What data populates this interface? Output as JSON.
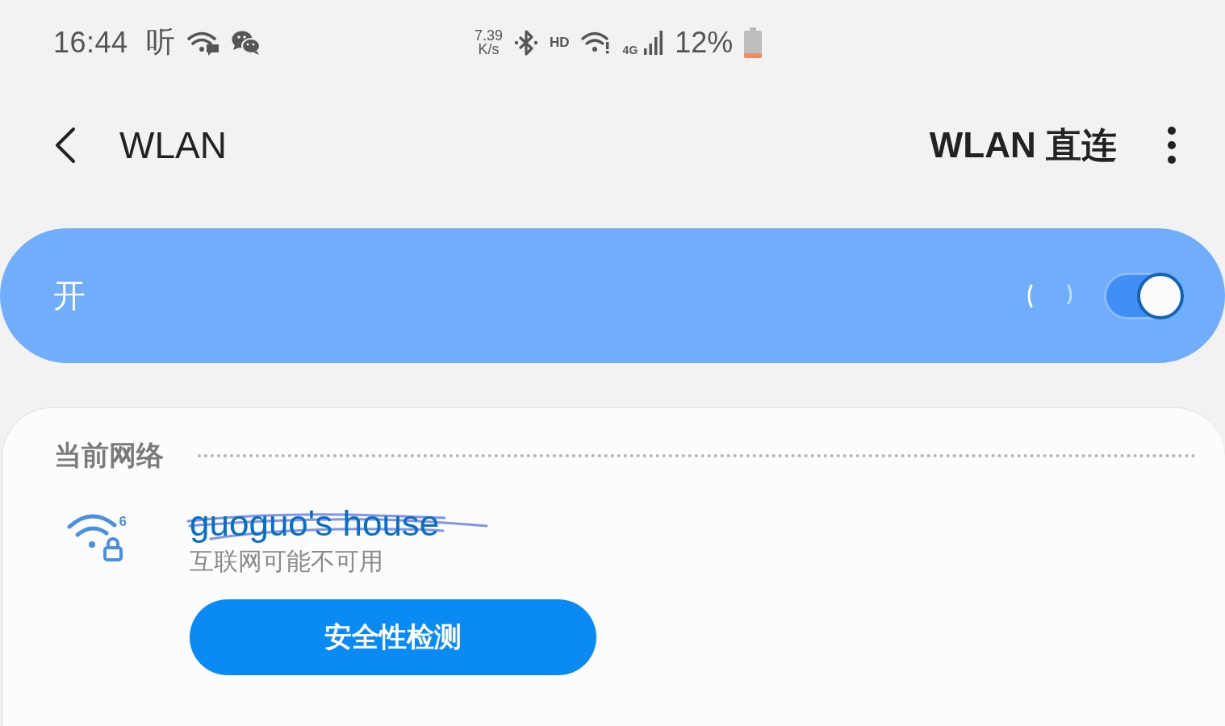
{
  "status_bar": {
    "time": "16:44",
    "notification_glyph": "听",
    "net_speed_value": "7.39",
    "net_speed_unit": "K/s",
    "hd_label": "HD",
    "network_type": "4G",
    "battery_percent": "12%"
  },
  "header": {
    "title": "WLAN",
    "action": "WLAN 直连"
  },
  "master_switch": {
    "label": "开",
    "on": true,
    "busy": true
  },
  "current_network": {
    "section_title": "当前网络",
    "network": {
      "wifi_standard": "6",
      "name": "guoguo's house",
      "secured": true,
      "redacted": true,
      "status": "互联网可能不可用"
    },
    "button": "安全性检测"
  }
}
